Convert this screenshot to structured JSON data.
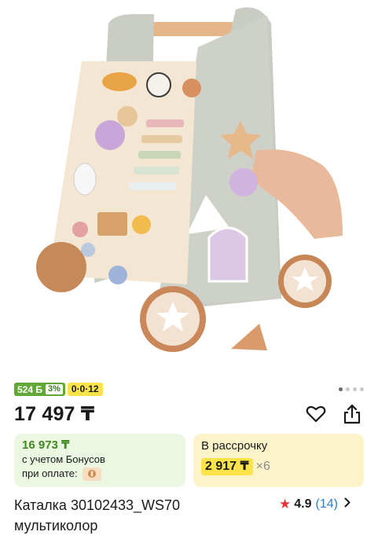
{
  "product": {
    "image_alt": "wooden activity walker",
    "bonus_badge": {
      "value": "524 Б",
      "percent": "3%"
    },
    "installment_badge": "0·0·12",
    "gallery_dots": {
      "count": 4,
      "active_index": 0
    },
    "price": "17 497 ₸",
    "bonus_card": {
      "amount": "16 973 ₸",
      "note_line1": "с учетом Бонусов",
      "note_line2": "при оплате:",
      "icon": "wallet-icon"
    },
    "installment_card": {
      "label": "В рассрочку",
      "monthly": "2 917 ₸",
      "multiplier": "×6"
    },
    "title": "Каталка 30102433_WS70 мультиколор",
    "rating": {
      "score": "4.9",
      "reviews": "(14)"
    },
    "icons": {
      "favorite": "heart-icon",
      "share": "share-icon",
      "rating": "star-icon",
      "more": "chevron-right-icon"
    },
    "colors": {
      "bonus_green": "#62a838",
      "installment_yellow": "#fde34a",
      "star_red": "#e4343a",
      "link_blue": "#2d7bd7"
    }
  }
}
